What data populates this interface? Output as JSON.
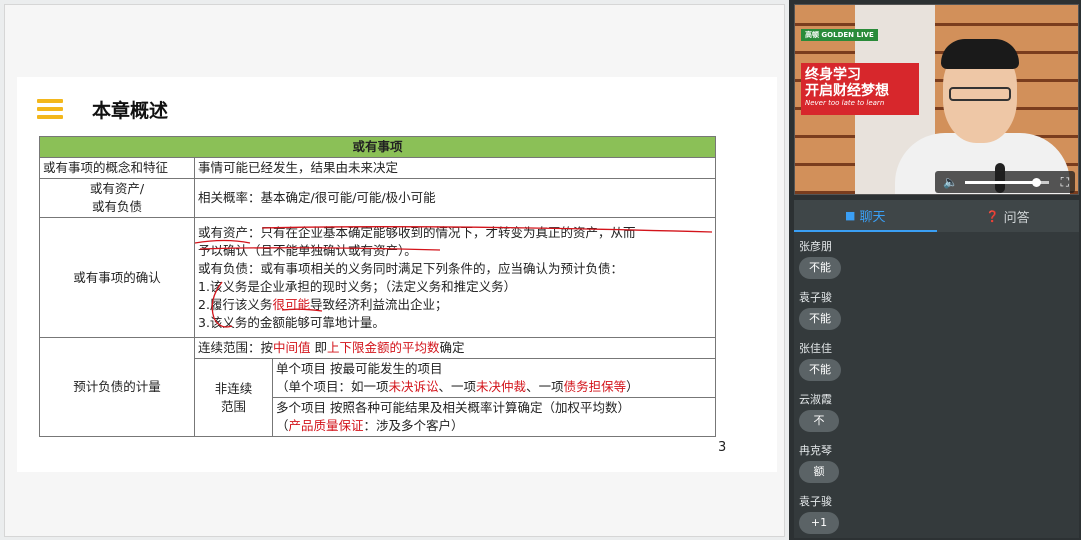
{
  "slide": {
    "title": "本章概述",
    "page_number": "3",
    "table": {
      "header": "或有事项",
      "r1_label": "或有事项的概念和特征",
      "r1_value": "事情可能已经发生，结果由未来决定",
      "r2_label_l1": "或有资产/",
      "r2_label_l2": "或有负债",
      "r2_value": "相关概率：基本确定/很可能/可能/极小可能",
      "r3_label": "或有事项的确认",
      "r3_l1": "或有资产：只有在企业基本确定能够收到的情况下，才转变为真正的资产，从而",
      "r3_l2": "予以确认（且不能单独确认或有资产）。",
      "r3_l3": "或有负债：或有事项相关的义务同时满足下列条件的，应当确认为预计负债：",
      "r3_l4": "1.该义务是企业承担的现时义务；（法定义务和推定义务）",
      "r3_l5a": "2.履行该义务",
      "r3_l5b": "很可能",
      "r3_l5c": "导致经济利益流出企业；",
      "r3_l6": "3.该义务的金额能够可靠地计量。",
      "r4_label": "预计负债的计量",
      "r4_cont_a": "连续范围：按",
      "r4_cont_b": "中间值",
      "r4_cont_c": " 即",
      "r4_cont_d": "上下限金额的平均数",
      "r4_cont_e": "确定",
      "r4_noncont_l1": "非连续",
      "r4_noncont_l2": "范围",
      "r4_single_l1": "单个项目 按最可能发生的项目",
      "r4_single_a": "（单个项目：如一项",
      "r4_single_b": "未决诉讼",
      "r4_single_c": "、一项",
      "r4_single_d": "未决仲裁",
      "r4_single_e": "、一项",
      "r4_single_f": "债务担保等",
      "r4_single_g": "）",
      "r4_multi_l1": "多个项目 按照各种可能结果及相关概率计算确定（加权平均数）",
      "r4_multi_a": "（",
      "r4_multi_b": "产品质量保证",
      "r4_multi_c": "：涉及多个客户）"
    }
  },
  "video": {
    "logo": "高顿 GOLDEN LIVE",
    "banner_l1": "终身学习",
    "banner_l2": "开启财经梦想",
    "banner_l3": "Never too late to learn",
    "volume": 0.85
  },
  "panel": {
    "tab_chat": "聊天",
    "tab_qa": "问答",
    "messages": [
      {
        "name": "张彦朋",
        "text": "不能"
      },
      {
        "name": "袁子骏",
        "text": "不能"
      },
      {
        "name": "张佳佳",
        "text": "不能"
      },
      {
        "name": "云淑霞",
        "text": "不"
      },
      {
        "name": "冉克琴",
        "text": "额"
      },
      {
        "name": "袁子骏",
        "text": "+1"
      }
    ]
  },
  "colors": {
    "header_green": "#8bc057",
    "accent_red": "#d3141b",
    "tab_blue": "#3a9ff5"
  }
}
